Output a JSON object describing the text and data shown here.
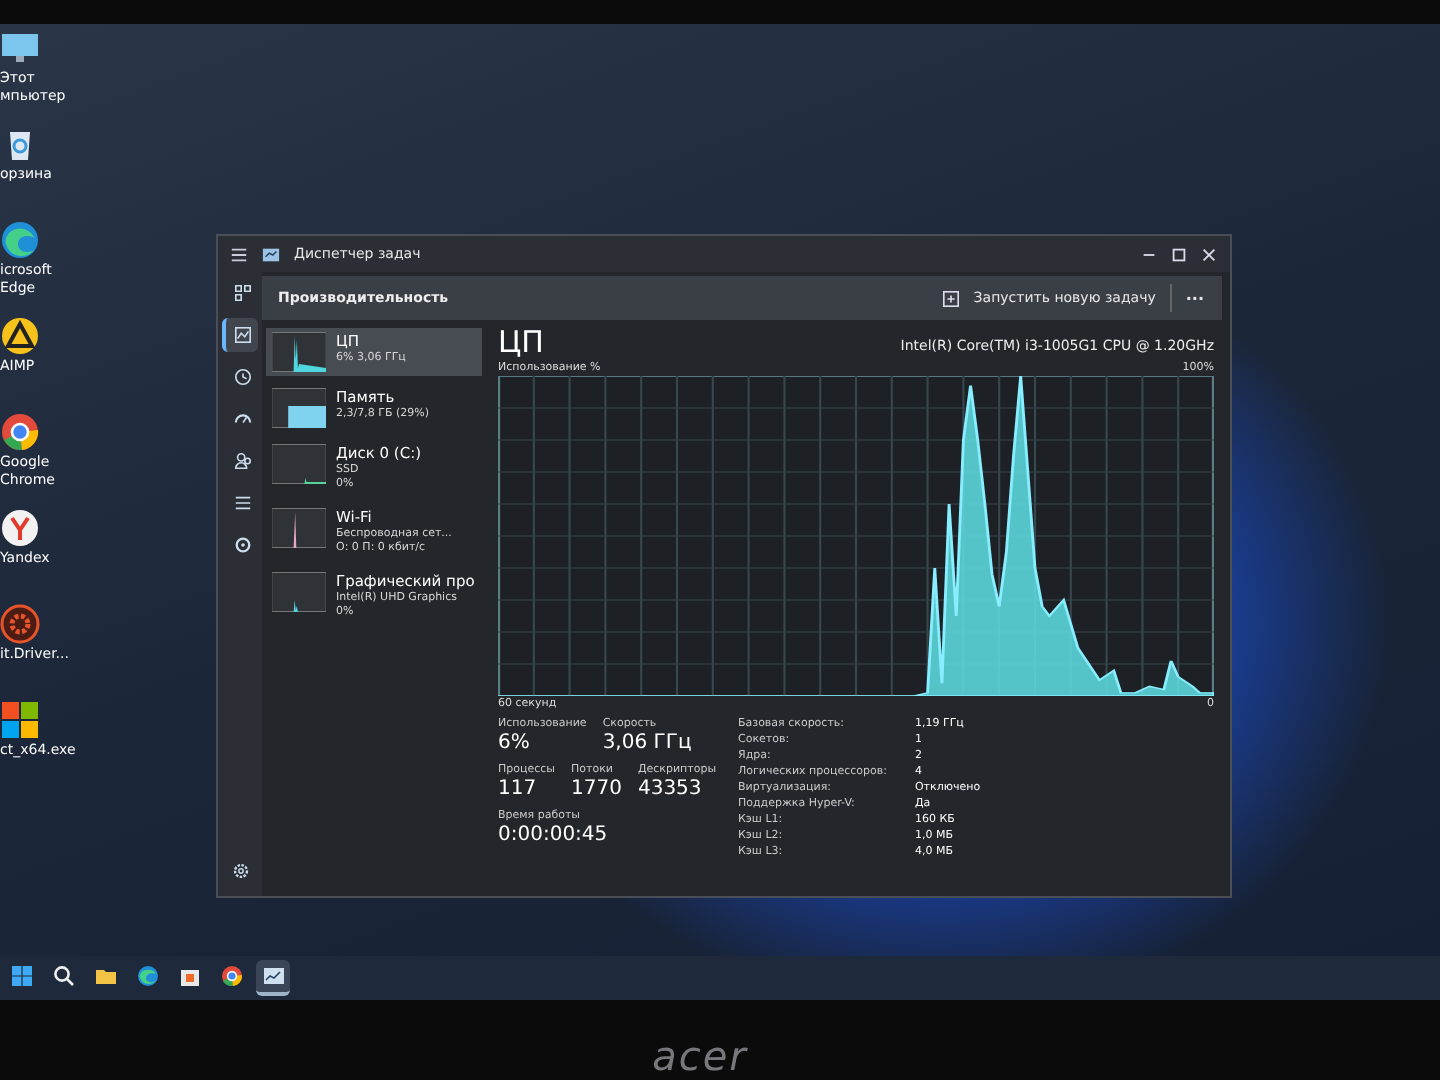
{
  "desktop_icons": [
    {
      "kind": "computer",
      "lines": [
        "Этот",
        "мпьютер"
      ]
    },
    {
      "kind": "bin",
      "lines": [
        "орзина"
      ]
    },
    {
      "kind": "edge",
      "lines": [
        "icrosoft",
        "Edge"
      ]
    },
    {
      "kind": "aimp",
      "lines": [
        "AIMP"
      ]
    },
    {
      "kind": "chrome",
      "lines": [
        "Google",
        "Chrome"
      ]
    },
    {
      "kind": "yandex",
      "lines": [
        "Yandex"
      ]
    },
    {
      "kind": "driver",
      "lines": [
        "it.Driver..."
      ]
    },
    {
      "kind": "ms",
      "lines": [
        "ct_x64.exe"
      ]
    }
  ],
  "window": {
    "title": "Диспетчер задач",
    "page_title": "Производительность",
    "run_task_button": "Запустить новую задачу",
    "more_button": "···",
    "nav": [
      {
        "kind": "processes",
        "selected": false
      },
      {
        "kind": "performance",
        "selected": true
      },
      {
        "kind": "history",
        "selected": false
      },
      {
        "kind": "startup",
        "selected": false
      },
      {
        "kind": "users",
        "selected": false
      },
      {
        "kind": "details",
        "selected": false
      },
      {
        "kind": "services",
        "selected": false
      }
    ],
    "resources": [
      {
        "title": "ЦП",
        "lines": [
          "6% 3,06 ГГц"
        ],
        "color": "#4fd6de",
        "selected": true
      },
      {
        "title": "Память",
        "lines": [
          "2,3/7,8 ГБ (29%)"
        ],
        "color": "#7fd3ef",
        "selected": false
      },
      {
        "title": "Диск 0 (C:)",
        "lines": [
          "SSD",
          "0%"
        ],
        "color": "#55d39a",
        "selected": false
      },
      {
        "title": "Wi-Fi",
        "lines": [
          "Беспроводная сет...",
          "О: 0 П: 0 кбит/с"
        ],
        "color": "#e8a6c8",
        "selected": false
      },
      {
        "title": "Графический про",
        "lines": [
          "Intel(R) UHD Graphics",
          "0%"
        ],
        "color": "#4fd6de",
        "selected": false
      }
    ],
    "detail": {
      "title": "ЦП",
      "cpu_name": "Intel(R) Core(TM) i3-1005G1 CPU @ 1.20GHz",
      "graph_label": "Использование %",
      "graph_max": "100%",
      "graph_time": "60 секунд",
      "graph_min": "0",
      "stats": [
        [
          {
            "label": "Использование",
            "value": "6%"
          },
          {
            "label": "Скорость",
            "value": "3,06 ГГц"
          }
        ],
        [
          {
            "label": "Процессы",
            "value": "117"
          },
          {
            "label": "Потоки",
            "value": "1770"
          },
          {
            "label": "Дескрипторы",
            "value": "43353"
          }
        ],
        [
          {
            "label": "Время работы",
            "value": "0:00:00:45"
          }
        ]
      ],
      "specs": [
        {
          "label": "Базовая скорость:",
          "value": "1,19 ГГц"
        },
        {
          "label": "Сокетов:",
          "value": "1"
        },
        {
          "label": "Ядра:",
          "value": "2"
        },
        {
          "label": "Логических процессоров:",
          "value": "4"
        },
        {
          "label": "Виртуализация:",
          "value": "Отключено"
        },
        {
          "label": "Поддержка Hyper-V:",
          "value": "Да"
        },
        {
          "label": "Кэш L1:",
          "value": "160 КБ"
        },
        {
          "label": "Кэш L2:",
          "value": "1,0 МБ"
        },
        {
          "label": "Кэш L3:",
          "value": "4,0 МБ"
        }
      ]
    }
  },
  "taskbar": [
    {
      "kind": "start",
      "active": false
    },
    {
      "kind": "search",
      "active": false
    },
    {
      "kind": "folder",
      "active": false
    },
    {
      "kind": "edge",
      "active": false
    },
    {
      "kind": "store",
      "active": false
    },
    {
      "kind": "chrome",
      "active": false
    },
    {
      "kind": "taskmgr",
      "active": true
    }
  ],
  "bezel_logo": "acer"
}
